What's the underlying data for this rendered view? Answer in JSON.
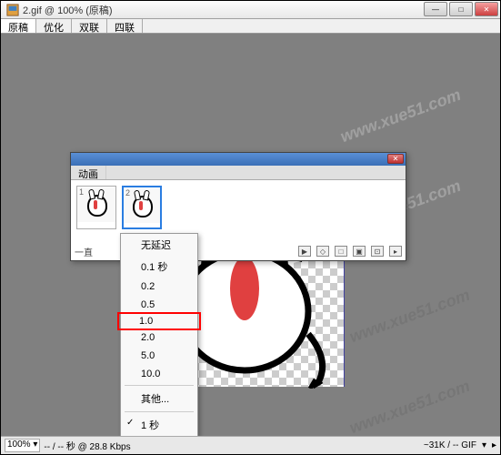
{
  "window": {
    "title": "2.gif @ 100% (原稿)",
    "controls": {
      "min": "—",
      "max": "□",
      "close": "✕"
    }
  },
  "tabs": [
    "原稿",
    "优化",
    "双联",
    "四联"
  ],
  "panel": {
    "tab_label": "动画",
    "close": "✕",
    "frames": [
      {
        "num": "1",
        "delay": ""
      },
      {
        "num": "2",
        "delay": ""
      }
    ],
    "toolbar": {
      "label": "一直",
      "icons": [
        "▶",
        "◇",
        "□",
        "▣",
        "⊡",
        "▸"
      ]
    }
  },
  "menu": {
    "items": [
      "无延迟",
      "0.1 秒",
      "0.2",
      "0.5",
      "1.0",
      "2.0",
      "5.0",
      "10.0"
    ],
    "other": "其他...",
    "checked": "1 秒"
  },
  "status": {
    "zoom": "100%",
    "rate": "-- / -- 秒 @ 28.8 Kbps",
    "size": "~31K / -- GIF"
  },
  "watermark": "www.xue51.com"
}
